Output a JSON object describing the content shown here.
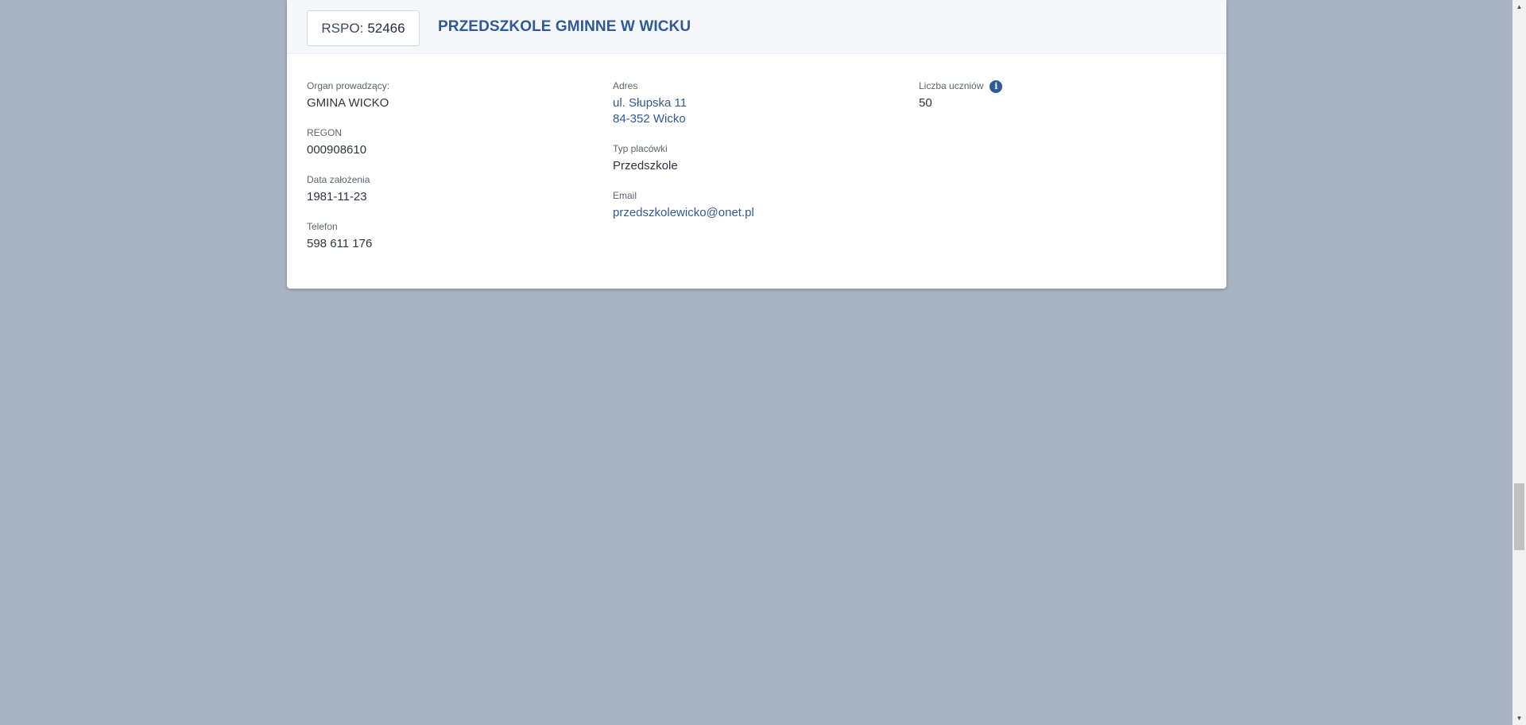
{
  "school": {
    "rspo_label": "RSPO:",
    "rspo_value": "52466",
    "name": "PRZEDSZKOLE GMINNE W WICKU"
  },
  "fields": {
    "organ": {
      "label": "Organ prowadzący:",
      "value": "GMINA WICKO"
    },
    "regon": {
      "label": "REGON",
      "value": "000908610"
    },
    "founded": {
      "label": "Data założenia",
      "value": "1981-11-23"
    },
    "phone": {
      "label": "Telefon",
      "value": "598 611 176"
    },
    "address": {
      "label": "Adres",
      "line1": "ul. Słupska 11",
      "line2": "84-352 Wicko"
    },
    "type": {
      "label": "Typ placówki",
      "value": "Przedszkole"
    },
    "email": {
      "label": "Email",
      "value": "przedszkolewicko@onet.pl"
    },
    "students": {
      "label": "Liczba uczniów",
      "value": "50",
      "info_icon": "info-icon"
    }
  },
  "colors": {
    "page_background": "#a8b3c1",
    "accent": "#2f5a94",
    "header_background": "#f5f7fb"
  }
}
